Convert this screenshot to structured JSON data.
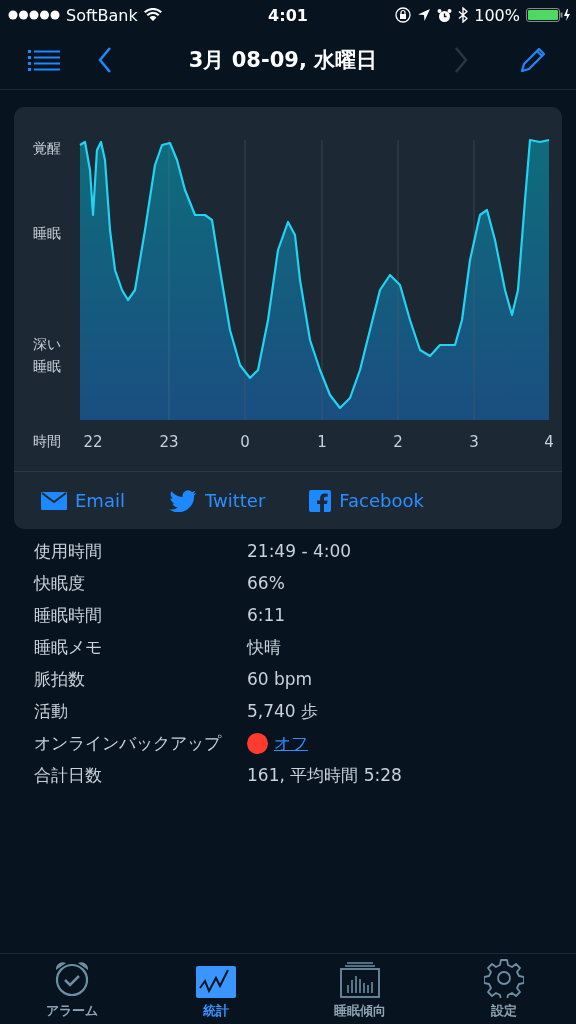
{
  "status_bar": {
    "carrier": "SoftBank",
    "time": "4:01",
    "battery": "100%"
  },
  "nav": {
    "title": "3月 08-09, 水曜日",
    "next_disabled": true
  },
  "chart": {
    "y_labels": [
      "覚醒",
      "睡眠",
      "深い睡眠"
    ],
    "x_title": "時間",
    "x_labels": [
      "22",
      "23",
      "0",
      "1",
      "2",
      "3",
      "4"
    ]
  },
  "share": [
    {
      "kind": "email",
      "label": "Email"
    },
    {
      "kind": "twitter",
      "label": "Twitter"
    },
    {
      "kind": "facebook",
      "label": "Facebook"
    }
  ],
  "details": [
    {
      "label": "使用時間",
      "value": "21:49 - 4:00"
    },
    {
      "label": "快眠度",
      "value": "66%"
    },
    {
      "label": "睡眠時間",
      "value": "6:11"
    },
    {
      "label": "睡眠メモ",
      "value": "快晴"
    },
    {
      "label": "脈拍数",
      "value": "60 bpm"
    },
    {
      "label": "活動",
      "value": "5,740 歩"
    },
    {
      "label": "オンラインバックアップ",
      "value": "オフ",
      "kind": "link",
      "color": "#ff3b30"
    },
    {
      "label": "合計日数",
      "value": "161, 平均時間 5:28"
    }
  ],
  "tabs": [
    {
      "kind": "alarm",
      "label": "アラーム",
      "selected": false
    },
    {
      "kind": "stats",
      "label": "統計",
      "selected": true
    },
    {
      "kind": "trends",
      "label": "睡眠傾向",
      "selected": false
    },
    {
      "kind": "settings",
      "label": "設定",
      "selected": false
    }
  ]
}
